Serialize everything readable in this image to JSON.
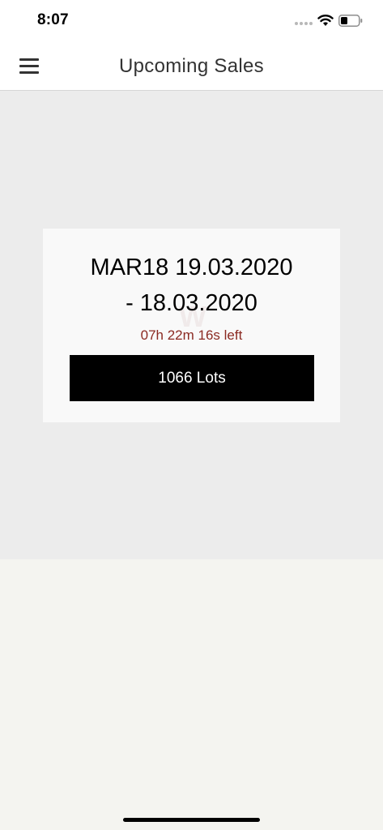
{
  "status_bar": {
    "time": "8:07"
  },
  "nav": {
    "title": "Upcoming Sales",
    "menu_icon": "hamburger-menu-icon"
  },
  "sale": {
    "title_line1": "MAR18 19.03.2020",
    "title_line2": "- 18.03.2020",
    "countdown": "07h 22m 16s left",
    "lots_label": "1066 Lots"
  },
  "colors": {
    "countdown": "#8b2a22",
    "button_bg": "#000000",
    "hero_bg": "#ececec",
    "page_bg": "#f4f4f0"
  }
}
